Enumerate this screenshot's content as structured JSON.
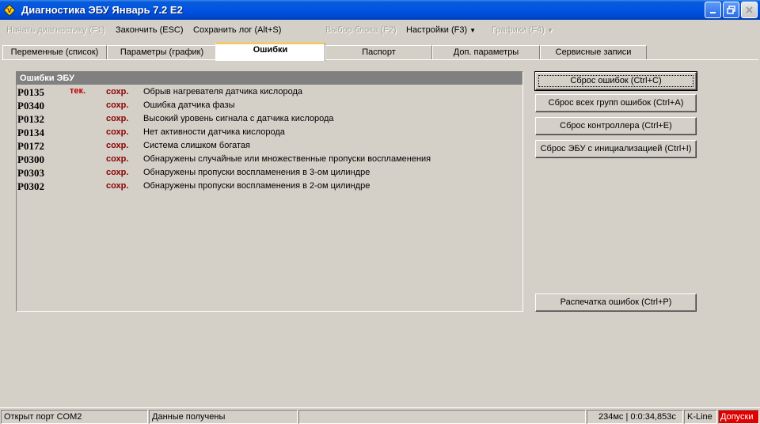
{
  "window": {
    "title": "Диагностика ЭБУ Январь 7.2 E2"
  },
  "menu": {
    "start_diag": "Начать диагностику (F1)",
    "finish": "Закончить (ESC)",
    "save_log": "Сохранить лог (Alt+S)",
    "select_blocks": "Выбор блока (F2)",
    "settings": "Настройки (F3)",
    "graphs": "Графики (F4)"
  },
  "tabs": [
    {
      "label": "Переменные (список)"
    },
    {
      "label": "Параметры (график)"
    },
    {
      "label": "Ошибки",
      "active": true
    },
    {
      "label": "Паспорт"
    },
    {
      "label": "Доп. параметры"
    },
    {
      "label": "Сервисные записи"
    }
  ],
  "errors": {
    "header": "Ошибки ЭБУ",
    "rows": [
      {
        "code": "P0135",
        "current": "тек.",
        "saved": "сохр.",
        "desc": "Обрыв нагревателя датчика кислорода"
      },
      {
        "code": "P0340",
        "current": "",
        "saved": "сохр.",
        "desc": "Ошибка датчика фазы"
      },
      {
        "code": "P0132",
        "current": "",
        "saved": "сохр.",
        "desc": "Высокий уровень сигнала с датчика кислорода"
      },
      {
        "code": "P0134",
        "current": "",
        "saved": "сохр.",
        "desc": "Нет активности датчика кислорода"
      },
      {
        "code": "P0172",
        "current": "",
        "saved": "сохр.",
        "desc": "Система слишком богатая"
      },
      {
        "code": "P0300",
        "current": "",
        "saved": "сохр.",
        "desc": "Обнаружены случайные или множественные пропуски воспламенения"
      },
      {
        "code": "P0303",
        "current": "",
        "saved": "сохр.",
        "desc": "Обнаружены пропуски воспламенения в 3-ом цилиндре"
      },
      {
        "code": "P0302",
        "current": "",
        "saved": "сохр.",
        "desc": "Обнаружены пропуски воспламенения в 2-ом цилиндре"
      }
    ]
  },
  "buttons": {
    "reset_errors": "Сброс ошибок (Ctrl+C)",
    "reset_all_groups": "Сброс всех групп ошибок (Ctrl+A)",
    "reset_controller": "Сброс контроллера (Ctrl+E)",
    "reset_ecu_init": "Сброс ЭБУ с инициализацией (Ctrl+I)",
    "print_errors": "Распечатка ошибок (Ctrl+P)"
  },
  "status": {
    "port": "Открыт порт COM2",
    "data": "Данные получены",
    "timing": "234мс | 0:0:34,853с",
    "interface": "K-Line",
    "alert": "Допуски"
  },
  "colors": {
    "titlebar": "#0054e3",
    "current_error": "#c00000",
    "saved_error": "#8b0000",
    "alert_bg": "#e00000"
  },
  "icons": {
    "app": "app-logo-icon",
    "minimize": "minimize-icon",
    "maximize": "maximize-icon",
    "close": "close-icon"
  }
}
